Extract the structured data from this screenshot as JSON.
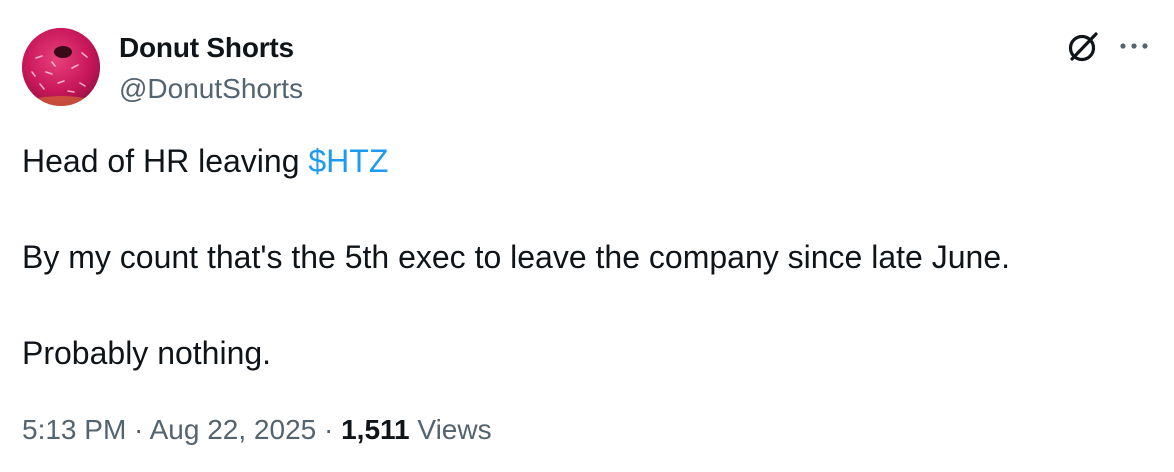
{
  "user": {
    "display_name": "Donut Shorts",
    "handle": "@DonutShorts",
    "avatar_icon": "pink-donut-avatar"
  },
  "actions": {
    "grok_icon": "grok-icon",
    "more_icon": "more-options-icon"
  },
  "tweet": {
    "line1_text": "Head of HR leaving ",
    "cashtag": "$HTZ",
    "line2_text": "By my count that's the 5th exec to leave the company since late June.",
    "line3_text": "Probably nothing."
  },
  "meta": {
    "time": "5:13 PM",
    "separator1": " · ",
    "date": "Aug 22, 2025",
    "separator2": " · ",
    "views_count": "1,511",
    "views_label": " Views"
  },
  "colors": {
    "text": "#0f1419",
    "secondary": "#536471",
    "link": "#1d9bf0",
    "avatar_pink": "#d11a5c"
  }
}
